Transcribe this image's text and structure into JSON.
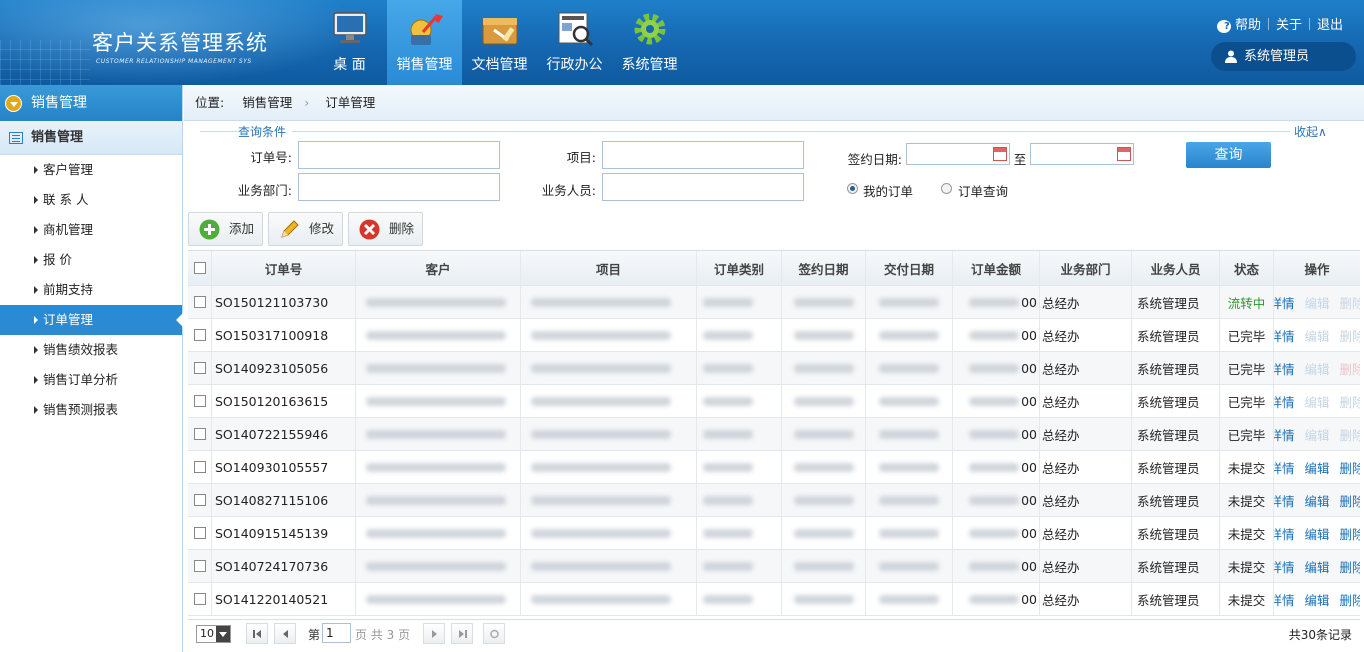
{
  "app": {
    "title": "客户关系管理系统",
    "subtitle": "CUSTOMER RELATIONSHIP MANAGEMENT SYS"
  },
  "nav": {
    "items": [
      {
        "label": "桌 面",
        "icon": "desktop-icon"
      },
      {
        "label": "销售管理",
        "icon": "sales-chart-icon",
        "active": true
      },
      {
        "label": "文档管理",
        "icon": "document-box-icon"
      },
      {
        "label": "行政办公",
        "icon": "news-search-icon"
      },
      {
        "label": "系统管理",
        "icon": "gear-icon"
      }
    ]
  },
  "toplinks": {
    "help": "帮助",
    "about": "关于",
    "logout": "退出"
  },
  "user": {
    "name": "系统管理员"
  },
  "sidebar": {
    "top": "销售管理",
    "section": "销售管理",
    "items": [
      {
        "label": "客户管理"
      },
      {
        "label": "联 系 人"
      },
      {
        "label": "商机管理"
      },
      {
        "label": "报  价"
      },
      {
        "label": "前期支持"
      },
      {
        "label": "订单管理",
        "active": true
      },
      {
        "label": "销售绩效报表"
      },
      {
        "label": "销售订单分析"
      },
      {
        "label": "销售预测报表"
      }
    ]
  },
  "breadcrumb": {
    "prefix": "位置:",
    "level1": "销售管理",
    "level2": "订单管理"
  },
  "search": {
    "legend": "查询条件",
    "collapse": "收起∧",
    "order_no_label": "订单号:",
    "project_label": "项目:",
    "sign_date_label": "签约日期:",
    "to_label": "至",
    "dept_label": "业务部门:",
    "staff_label": "业务人员:",
    "radio_mine": "我的订单",
    "radio_query": "订单查询",
    "query_button": "查询"
  },
  "toolbar": {
    "add": "添加",
    "edit": "修改",
    "delete": "删除"
  },
  "table": {
    "headers": [
      "订单号",
      "客户",
      "项目",
      "订单类别",
      "签约日期",
      "交付日期",
      "订单金额",
      "业务部门",
      "业务人员",
      "状态",
      "操作"
    ],
    "rows": [
      {
        "order_no": "SO150121103730",
        "amount_tail": "00",
        "dept": "总经办",
        "staff": "系统管理员",
        "status": "流转中",
        "status_type": "flow",
        "actions": [
          "详情",
          "编辑",
          "删除"
        ],
        "edit_enabled": false
      },
      {
        "order_no": "SO150317100918",
        "amount_tail": "00",
        "dept": "总经办",
        "staff": "系统管理员",
        "status": "已完毕",
        "status_type": "done",
        "actions": [
          "详情",
          "编辑",
          "删除"
        ],
        "edit_enabled": false
      },
      {
        "order_no": "SO140923105056",
        "amount_tail": "00",
        "dept": "总经办",
        "staff": "系统管理员",
        "status": "已完毕",
        "status_type": "done",
        "actions": [
          "详情",
          "编辑",
          "删除"
        ],
        "edit_enabled": false
      },
      {
        "order_no": "SO150120163615",
        "amount_tail": "00",
        "dept": "总经办",
        "staff": "系统管理员",
        "status": "已完毕",
        "status_type": "done",
        "actions": [
          "详情",
          "编辑",
          "删除"
        ],
        "edit_enabled": false
      },
      {
        "order_no": "SO140722155946",
        "amount_tail": "00",
        "dept": "总经办",
        "staff": "系统管理员",
        "status": "已完毕",
        "status_type": "done",
        "actions": [
          "详情",
          "编辑",
          "删除"
        ],
        "edit_enabled": false
      },
      {
        "order_no": "SO140930105557",
        "amount_tail": "00",
        "dept": "总经办",
        "staff": "系统管理员",
        "status": "未提交",
        "status_type": "draft",
        "actions": [
          "详情",
          "编辑",
          "删除"
        ],
        "edit_enabled": true
      },
      {
        "order_no": "SO140827115106",
        "amount_tail": "00",
        "dept": "总经办",
        "staff": "系统管理员",
        "status": "未提交",
        "status_type": "draft",
        "actions": [
          "详情",
          "编辑",
          "删除"
        ],
        "edit_enabled": true
      },
      {
        "order_no": "SO140915145139",
        "amount_tail": "00",
        "dept": "总经办",
        "staff": "系统管理员",
        "status": "未提交",
        "status_type": "draft",
        "actions": [
          "详情",
          "编辑",
          "删除"
        ],
        "edit_enabled": true
      },
      {
        "order_no": "SO140724170736",
        "amount_tail": "00",
        "dept": "总经办",
        "staff": "系统管理员",
        "status": "未提交",
        "status_type": "draft",
        "actions": [
          "详情",
          "编辑",
          "删除"
        ],
        "edit_enabled": true
      },
      {
        "order_no": "SO141220140521",
        "amount_tail": "00",
        "dept": "总经办",
        "staff": "系统管理员",
        "status": "未提交",
        "status_type": "draft",
        "actions": [
          "详情",
          "编辑",
          "删除"
        ],
        "edit_enabled": true
      }
    ]
  },
  "pager": {
    "page_size": "10",
    "page_prefix": "第",
    "page_value": "1",
    "page_suffix": "页 共 3 页",
    "total": "共30条记录"
  },
  "colors": {
    "header_blue": "#1567b0",
    "accent_blue": "#2a8bd4",
    "status_flow": "#2a9a2a",
    "link": "#1a6fb8"
  }
}
